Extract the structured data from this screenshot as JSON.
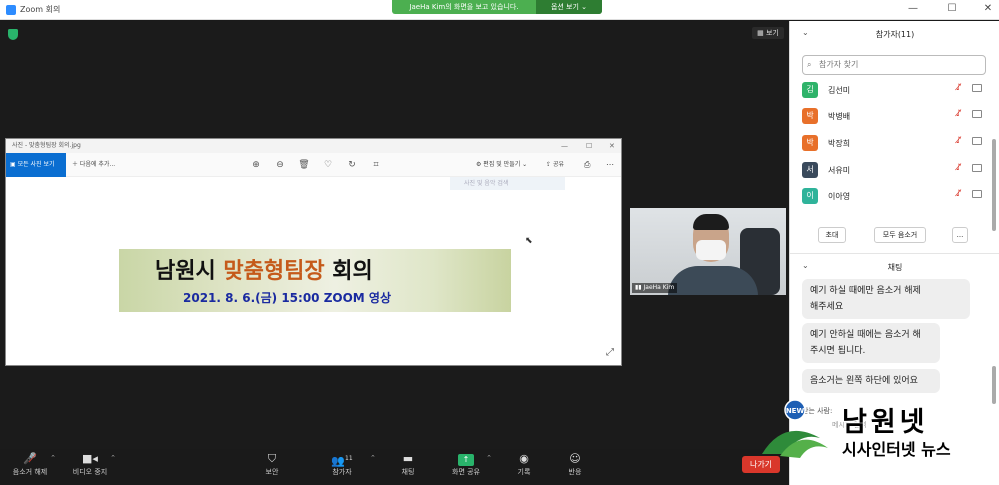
{
  "window": {
    "title": "Zoom 회의"
  },
  "share_banner": {
    "message": "JaeHa Kim의 화면을 보고 있습니다.",
    "view_options": "옵션 보기 ⌄"
  },
  "stage": {
    "view_button": "보기"
  },
  "photo_viewer": {
    "title": "사진 - 맞춤형팀장 회의.jpg",
    "all_photos": "모든 사진 보기",
    "add_to": "다음에 추가...",
    "edit_create": "편집 및 만들기 ⌄",
    "share": "공유",
    "search_placeholder": "사진 및 음악 검색",
    "banner": {
      "title_a": "남원시 ",
      "title_accent": "맞춤형팀장",
      "title_b": " 회의",
      "subtitle": "2021. 8. 6.(금) 15:00    ZOOM 영상"
    }
  },
  "video_tile": {
    "name": "JaeHa Kim"
  },
  "toolbar": {
    "unmute": "음소거 해제",
    "stop_video": "비디오 중지",
    "security": "보안",
    "participants": "참가자",
    "participants_count": "11",
    "chat": "채팅",
    "share_screen": "화면 공유",
    "record": "기록",
    "reactions": "반응",
    "leave": "나가기"
  },
  "panel": {
    "participants_title": "참가자(11)",
    "search_placeholder": "참가자 찾기",
    "participants": [
      {
        "initial": "김",
        "name": "김선미",
        "color": "#2fb36a"
      },
      {
        "initial": "박",
        "name": "박병배",
        "color": "#e8702a"
      },
      {
        "initial": "박",
        "name": "박장희",
        "color": "#e8702a"
      },
      {
        "initial": "서",
        "name": "서유미",
        "color": "#3a4a5c"
      },
      {
        "initial": "이",
        "name": "이아영",
        "color": "#2fb39a"
      }
    ],
    "invite": "초대",
    "mute_all": "모두 음소거",
    "more": "...",
    "chat_title": "채팅",
    "messages": [
      "예기 하실 때에만 음소거 해제\n해주세요",
      "예기 안하실 때에는 음소거 해\n주시면 됩니다.",
      "음소거는 왼쪽 하단에 있어요"
    ],
    "recipient": "받는 사람:",
    "input_placeholder": "메시지 입력"
  },
  "watermark": {
    "main": "남원넷",
    "sub": "시사인터넷 뉴스",
    "logo_text": "NEW"
  }
}
